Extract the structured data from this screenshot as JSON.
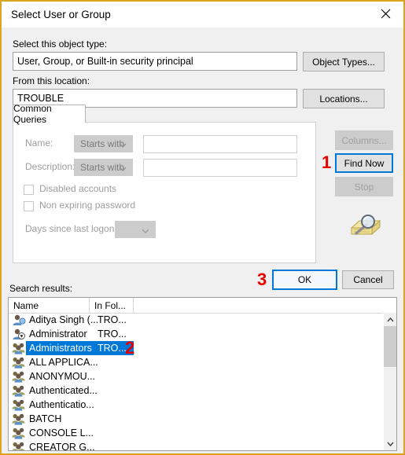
{
  "window": {
    "title": "Select User or Group",
    "close_icon": "close-icon",
    "border_color": "#d9a520"
  },
  "object_type": {
    "label": "Select this object type:",
    "value": "User, Group, or Built-in security principal",
    "button": "Object Types..."
  },
  "location": {
    "label": "From this location:",
    "value": "TROUBLE",
    "button": "Locations..."
  },
  "tabs": [
    {
      "label": "Common Queries",
      "selected": true
    }
  ],
  "query": {
    "name_label": "Name:",
    "name_operator": "Starts with",
    "name_value": "",
    "description_label": "Description:",
    "description_operator": "Starts with",
    "description_value": "",
    "disabled_accounts_label": "Disabled accounts",
    "disabled_accounts_checked": false,
    "non_expiring_label": "Non expiring password",
    "non_expiring_checked": false,
    "days_label": "Days since last logon:",
    "days_value": ""
  },
  "side_buttons": {
    "columns": "Columns...",
    "find_now": "Find Now",
    "stop": "Stop",
    "search_icon": "magnifier-folder-icon"
  },
  "dialog_buttons": {
    "ok": "OK",
    "cancel": "Cancel"
  },
  "results": {
    "label": "Search results:",
    "columns": [
      "Name",
      "In Fol..."
    ],
    "rows": [
      {
        "name": "Aditya Singh (...",
        "folder": "TRO...",
        "icon": "user-icon",
        "selected": false
      },
      {
        "name": "Administrator",
        "folder": "TRO...",
        "icon": "user-arrow-icon",
        "selected": false
      },
      {
        "name": "Administrators",
        "folder": "TRO...",
        "icon": "group-icon",
        "selected": true
      },
      {
        "name": "ALL APPLICA...",
        "folder": "",
        "icon": "group-icon",
        "selected": false
      },
      {
        "name": "ANONYMOU...",
        "folder": "",
        "icon": "group-icon",
        "selected": false
      },
      {
        "name": "Authenticated...",
        "folder": "",
        "icon": "group-icon",
        "selected": false
      },
      {
        "name": "Authenticatio...",
        "folder": "",
        "icon": "group-icon",
        "selected": false
      },
      {
        "name": "BATCH",
        "folder": "",
        "icon": "group-icon",
        "selected": false
      },
      {
        "name": "CONSOLE L...",
        "folder": "",
        "icon": "group-icon",
        "selected": false
      },
      {
        "name": "CREATOR G...",
        "folder": "",
        "icon": "group-icon",
        "selected": false
      }
    ]
  },
  "annotations": [
    {
      "text": "1"
    },
    {
      "text": "2"
    },
    {
      "text": "3"
    }
  ],
  "colors": {
    "selection": "#0078d7",
    "annotation": "#e60000",
    "accent": "#0078d7"
  }
}
